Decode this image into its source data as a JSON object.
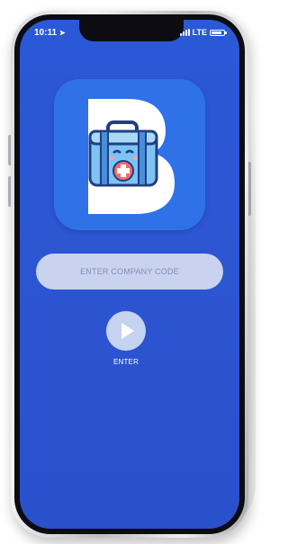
{
  "status_bar": {
    "time": "10:11",
    "network": "LTE"
  },
  "app_icon": {
    "icon": "medical-kit-b-logo-icon",
    "letter": "B",
    "background": "#2f72e8"
  },
  "company_code": {
    "placeholder": "ENTER COMPANY CODE",
    "value": ""
  },
  "enter_button": {
    "icon": "play-icon",
    "label": "ENTER"
  },
  "colors": {
    "screen_background": "#2b58d6",
    "input_background": "#c9d3ef",
    "button_background": "#c5d2f2"
  }
}
